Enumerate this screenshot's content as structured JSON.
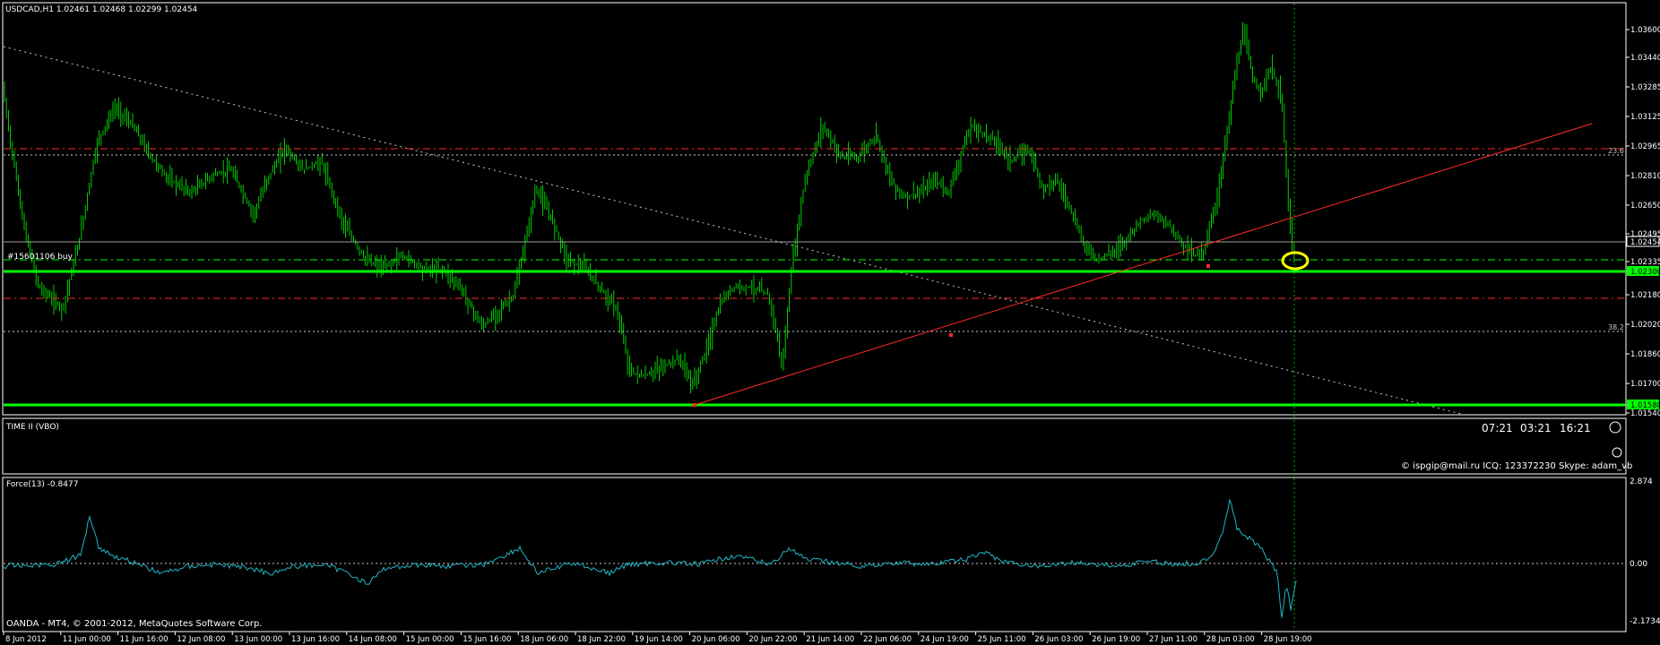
{
  "colors": {
    "background": "#000000",
    "grid": "#c0c0c0",
    "candle": "#00ff00",
    "level_line": "#00ff00",
    "resistance": "#ff2a2a",
    "force": "#21b6c4",
    "annotation": "#ffff00"
  },
  "price_panel": {
    "header": "USDCAD,H1  1.02461 1.02468 1.02299 1.02454",
    "order_label": "#15601106 buy",
    "fib_labels": [
      "23.6",
      "38.2"
    ]
  },
  "price_axis": {
    "labels": [
      "1.03600",
      "1.03440",
      "1.03285",
      "1.03125",
      "1.02965",
      "1.02810",
      "1.02650",
      "1.02495",
      "1.02454",
      "1.02335",
      "1.02300",
      "1.02180",
      "1.02020",
      "1.01860",
      "1.01700",
      "1.01580",
      "1.01540"
    ],
    "highlight_current": "1.02454",
    "highlight_entry": "1.02300",
    "highlight_low": "1.01580"
  },
  "time_panel": {
    "title": "TIME II (VBO)",
    "times": [
      "07:21",
      "03:21",
      "16:21"
    ],
    "contact": "© ispgip@mail.ru ICQ: 123372230 Skype: adam_vb"
  },
  "force_panel": {
    "title": "Force(13) -0.8477",
    "axis": [
      "2.874",
      "0.00",
      "-2.1734"
    ],
    "footer": "OANDA - MT4, © 2001-2012, MetaQuotes Software Corp."
  },
  "x_axis": [
    "8 Jun 2012",
    "11 Jun 00:00",
    "11 Jun 16:00",
    "12 Jun 08:00",
    "13 Jun 00:00",
    "13 Jun 16:00",
    "14 Jun 08:00",
    "15 Jun 00:00",
    "15 Jun 16:00",
    "18 Jun 06:00",
    "18 Jun 22:00",
    "19 Jun 14:00",
    "20 Jun 06:00",
    "20 Jun 22:00",
    "21 Jun 14:00",
    "22 Jun 06:00",
    "24 Jun 19:00",
    "25 Jun 11:00",
    "26 Jun 03:00",
    "26 Jun 19:00",
    "27 Jun 11:00",
    "28 Jun 03:00",
    "28 Jun 19:00"
  ]
}
